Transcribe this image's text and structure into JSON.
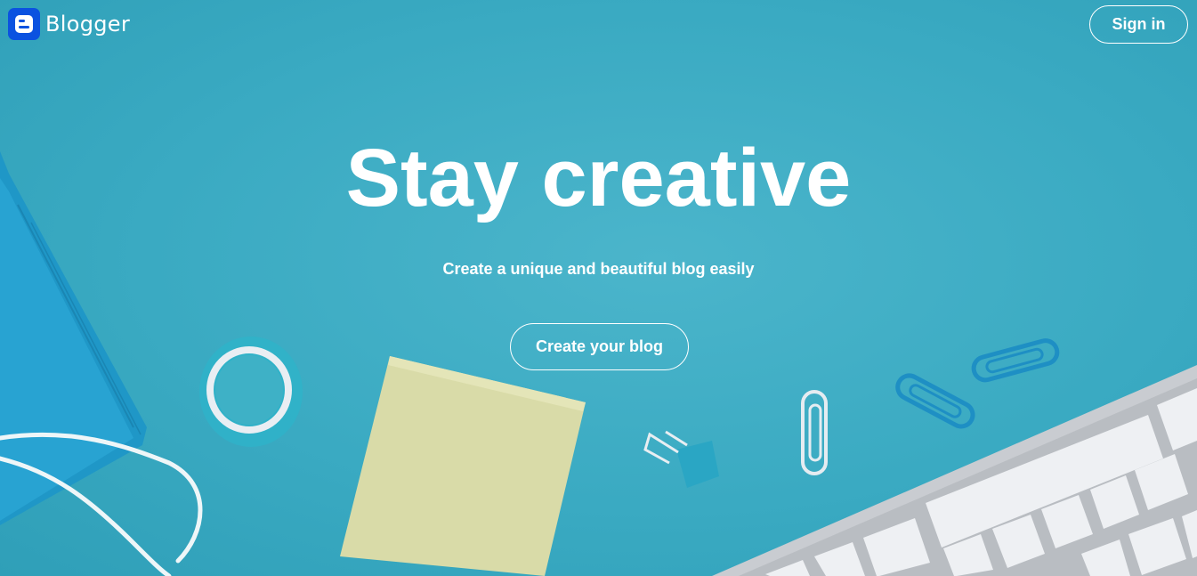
{
  "header": {
    "brand": "Blogger",
    "sign_in_label": "Sign in"
  },
  "hero": {
    "headline": "Stay creative",
    "subheadline": "Create a unique and beautiful blog easily",
    "cta_label": "Create your blog"
  },
  "icons": {
    "logo": "blogger-logo-icon"
  },
  "colors": {
    "background": "#36a9c0",
    "brand_blue": "#0b52e0",
    "text": "#ffffff"
  }
}
